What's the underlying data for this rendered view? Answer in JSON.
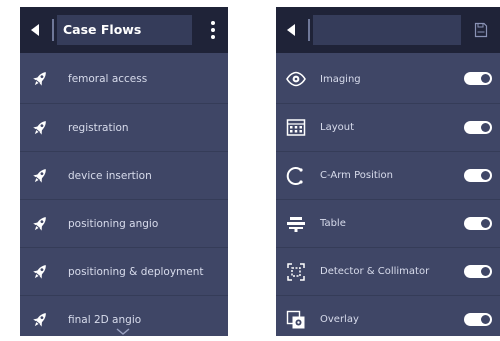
{
  "left_panel": {
    "title": "Case Flows",
    "items": [
      {
        "label": "femoral access",
        "icon": "flow-rocket-icon"
      },
      {
        "label": "registration",
        "icon": "flow-rocket-icon"
      },
      {
        "label": "device insertion",
        "icon": "flow-rocket-icon"
      },
      {
        "label": "positioning angio",
        "icon": "flow-rocket-icon"
      },
      {
        "label": "positioning & deployment",
        "icon": "flow-rocket-icon"
      },
      {
        "label": "final 2D angio",
        "icon": "flow-rocket-icon"
      }
    ]
  },
  "right_panel": {
    "title": "",
    "items": [
      {
        "label": "Imaging",
        "icon": "eye-icon",
        "enabled": true
      },
      {
        "label": "Layout",
        "icon": "layout-grid-icon",
        "enabled": true
      },
      {
        "label": "C-Arm Position",
        "icon": "c-arm-icon",
        "enabled": true
      },
      {
        "label": "Table",
        "icon": "table-icon",
        "enabled": true
      },
      {
        "label": "Detector & Collimator",
        "icon": "detector-icon",
        "enabled": true
      },
      {
        "label": "Overlay",
        "icon": "overlay-icon",
        "enabled": true
      }
    ]
  },
  "colors": {
    "panel_bg": "#3f4666",
    "header_bg": "#1f2338",
    "title_field_bg": "#353c5a",
    "text": "#d8dcec",
    "toggle_on": "#ffffff"
  }
}
